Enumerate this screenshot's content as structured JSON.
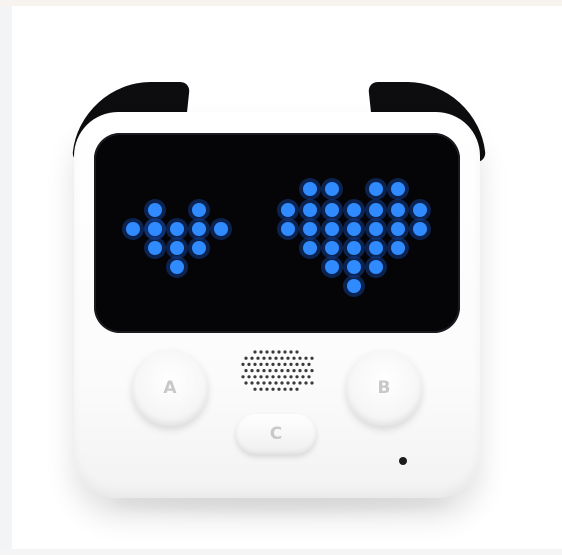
{
  "device": {
    "buttons": {
      "a_label": "A",
      "b_label": "B",
      "c_label": "C"
    },
    "display": {
      "led_color": "#2f8bff",
      "glow_color": "#123c8c",
      "left_eye": "heart-small",
      "right_eye": "heart-large"
    },
    "colors": {
      "body": "#ffffff",
      "ears": "#0d0d0f",
      "screen": "#050507"
    }
  }
}
